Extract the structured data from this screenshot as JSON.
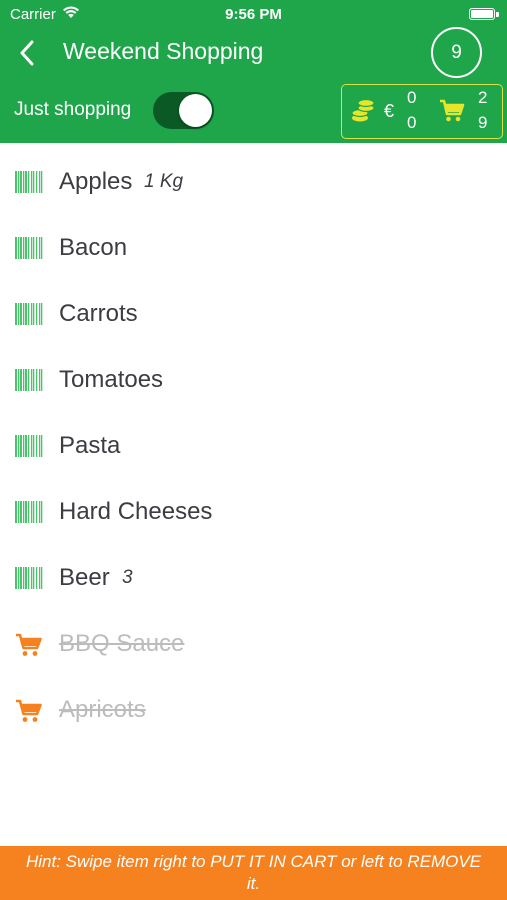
{
  "status_bar": {
    "carrier": "Carrier",
    "time": "9:56 PM"
  },
  "nav": {
    "title": "Weekend Shopping",
    "item_count": "9"
  },
  "mode": {
    "label": "Just shopping",
    "toggle_on": true
  },
  "totals": {
    "currency_symbol": "€",
    "price_remaining": "0",
    "price_in_cart": "0",
    "count_in_cart": "2",
    "count_total": "9"
  },
  "items": [
    {
      "name": "Apples",
      "qty": "1 Kg",
      "status": "to-buy",
      "icon": "barcode-icon"
    },
    {
      "name": "Bacon",
      "qty": "",
      "status": "to-buy",
      "icon": "barcode-icon"
    },
    {
      "name": "Carrots",
      "qty": "",
      "status": "to-buy",
      "icon": "barcode-icon"
    },
    {
      "name": "Tomatoes",
      "qty": "",
      "status": "to-buy",
      "icon": "barcode-icon"
    },
    {
      "name": "Pasta",
      "qty": "",
      "status": "to-buy",
      "icon": "barcode-icon"
    },
    {
      "name": "Hard Cheeses",
      "qty": "",
      "status": "to-buy",
      "icon": "barcode-icon"
    },
    {
      "name": "Beer",
      "qty": "3",
      "status": "to-buy",
      "icon": "barcode-icon"
    },
    {
      "name": "BBQ Sauce",
      "qty": "",
      "status": "in-cart",
      "icon": "cart-icon"
    },
    {
      "name": "Apricots",
      "qty": "",
      "status": "in-cart",
      "icon": "cart-icon"
    }
  ],
  "hint": "Hint: Swipe item right to PUT IT IN CART or left to REMOVE it.",
  "colors": {
    "header_green": "#1fa64b",
    "barcode_green": "#49c46b",
    "cart_orange": "#f5821f",
    "totals_yellow": "#e5e52a",
    "hint_orange": "#f5821f"
  }
}
